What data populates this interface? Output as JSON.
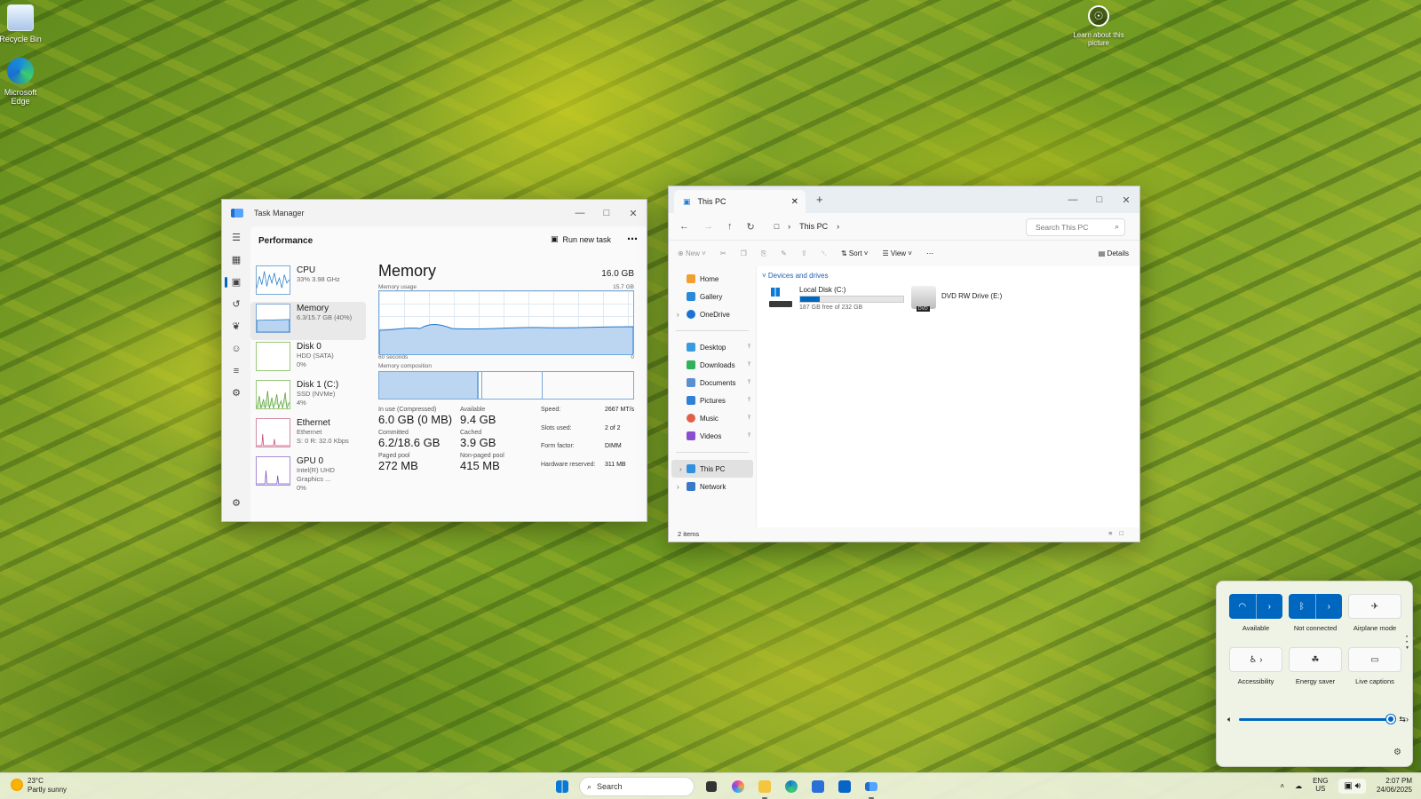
{
  "desktop": {
    "icons": [
      {
        "label": "Recycle Bin"
      },
      {
        "label": "Microsoft Edge"
      }
    ],
    "learn_label": "Learn about this picture"
  },
  "task_manager": {
    "title": "Task Manager",
    "page": "Performance",
    "run_new_task": "Run new task",
    "resources": [
      {
        "name": "CPU",
        "sub1": "33%  3.98 GHz",
        "sub2": "",
        "sub3": ""
      },
      {
        "name": "Memory",
        "sub1": "6.3/15.7 GB (40%)",
        "sub2": "",
        "sub3": ""
      },
      {
        "name": "Disk 0",
        "sub1": "HDD (SATA)",
        "sub2": "0%",
        "sub3": ""
      },
      {
        "name": "Disk 1 (C:)",
        "sub1": "SSD (NVMe)",
        "sub2": "4%",
        "sub3": ""
      },
      {
        "name": "Ethernet",
        "sub1": "Ethernet",
        "sub2": "S: 0  R: 32.0 Kbps",
        "sub3": ""
      },
      {
        "name": "GPU 0",
        "sub1": "Intel(R) UHD Graphics ...",
        "sub2": "0%",
        "sub3": ""
      }
    ],
    "memory": {
      "title": "Memory",
      "total": "16.0 GB",
      "usage_label": "Memory usage",
      "usage_max": "15.7 GB",
      "time_left": "60 seconds",
      "time_right": "0",
      "composition_label": "Memory composition",
      "usage_percent": 40,
      "in_use_label": "In use (Compressed)",
      "in_use": "6.0 GB (0 MB)",
      "available_label": "Available",
      "available": "9.4 GB",
      "committed_label": "Committed",
      "committed": "6.2/18.6 GB",
      "cached_label": "Cached",
      "cached": "3.9 GB",
      "paged_label": "Paged pool",
      "paged": "272 MB",
      "nonpaged_label": "Non-paged pool",
      "nonpaged": "415 MB",
      "speed_label": "Speed:",
      "speed": "2667 MT/s",
      "slots_label": "Slots used:",
      "slots": "2 of 2",
      "form_label": "Form factor:",
      "form": "DIMM",
      "hwres_label": "Hardware reserved:",
      "hwres": "311 MB"
    }
  },
  "explorer": {
    "tab_title": "This PC",
    "breadcrumb": "This PC",
    "search_placeholder": "Search This PC",
    "cmd": {
      "new": "New",
      "sort": "Sort",
      "view": "View",
      "details": "Details"
    },
    "nav": {
      "home": "Home",
      "gallery": "Gallery",
      "onedrive": "OneDrive",
      "desktop": "Desktop",
      "downloads": "Downloads",
      "documents": "Documents",
      "pictures": "Pictures",
      "music": "Music",
      "videos": "Videos",
      "thispc": "This PC",
      "network": "Network"
    },
    "group": "Devices and drives",
    "drives": [
      {
        "name": "Local Disk (C:)",
        "free": "187 GB free of 232 GB",
        "used_fraction": 0.19
      },
      {
        "name": "DVD RW Drive (E:)"
      }
    ],
    "status": "2 items"
  },
  "quick_settings": {
    "wifi": "Available",
    "bluetooth": "Not connected",
    "airplane": "Airplane mode",
    "accessibility": "Accessibility",
    "energy": "Energy saver",
    "captions": "Live captions",
    "volume_percent": 100
  },
  "taskbar": {
    "temp": "23°C",
    "weather": "Partly sunny",
    "search": "Search",
    "lang1": "ENG",
    "lang2": "US",
    "time": "2:07 PM",
    "date": "24/06/2025"
  }
}
